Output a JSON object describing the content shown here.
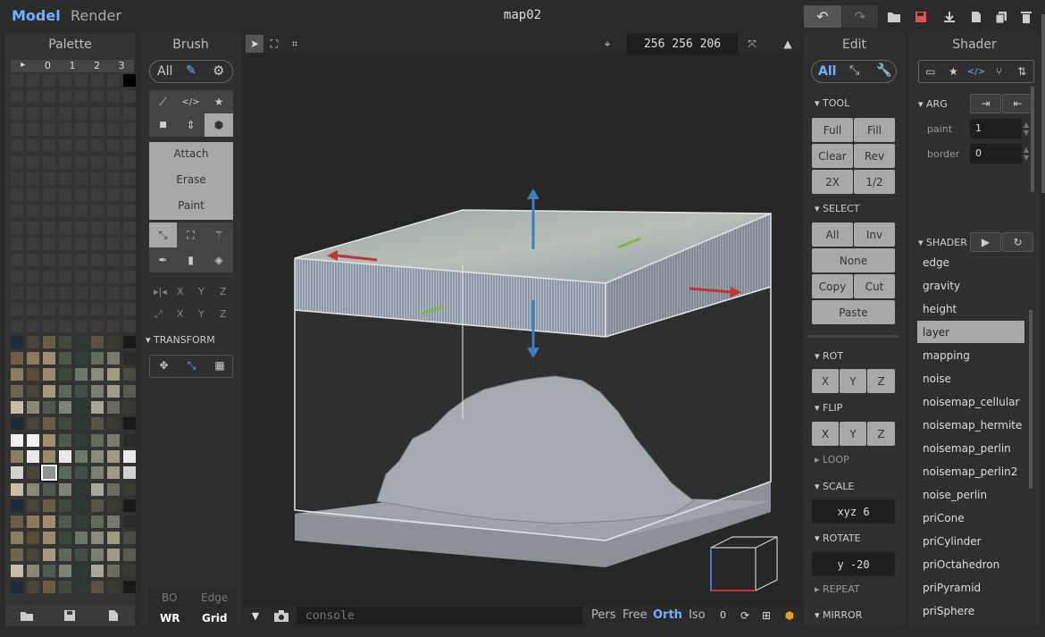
{
  "top": {
    "model": "Model",
    "render": "Render",
    "title": "map02"
  },
  "palette": {
    "title": "Palette",
    "tabs": [
      "▸",
      "0",
      "1",
      "2",
      "3"
    ]
  },
  "brush": {
    "title": "Brush",
    "all": "All",
    "actions": [
      "Attach",
      "Erase",
      "Paint"
    ],
    "transform": "TRANSFORM",
    "bo": "BO",
    "edge": "Edge",
    "wr": "WR",
    "grid": "Grid",
    "axes": [
      "X",
      "Y",
      "Z"
    ]
  },
  "viewport": {
    "size": "256 256 206",
    "console_placeholder": "console",
    "views": [
      "Pers",
      "Free",
      "Orth",
      "Iso"
    ],
    "count": "0"
  },
  "edit": {
    "title": "Edit",
    "all": "All",
    "tool": "TOOL",
    "tool_buttons": [
      "Full",
      "Fill",
      "Clear",
      "Rev",
      "2X",
      "1/2"
    ],
    "select": "SELECT",
    "select_buttons": [
      "All",
      "Inv",
      "None",
      "Copy",
      "Cut",
      "Paste"
    ],
    "rot": "ROT",
    "flip": "FLIP",
    "xyz": [
      "X",
      "Y",
      "Z"
    ],
    "loop": "LOOP",
    "scale": "SCALE",
    "scale_value": "xyz  6",
    "rotate": "ROTATE",
    "rotate_value": "y  -20",
    "repeat": "REPEAT",
    "mirror": "MIRROR"
  },
  "shader": {
    "title": "Shader",
    "arg": "ARG",
    "paint_label": "paint",
    "paint_value": "1",
    "border_label": "border",
    "border_value": "0",
    "shader_label": "SHADER",
    "items": [
      "edge",
      "gravity",
      "height",
      "layer",
      "mapping",
      "noise",
      "noisemap_cellular",
      "noisemap_hermite",
      "noisemap_perlin",
      "noisemap_perlin2",
      "noise_perlin",
      "priCone",
      "priCylinder",
      "priOctahedron",
      "priPyramid",
      "priSphere"
    ],
    "selected": "layer"
  }
}
